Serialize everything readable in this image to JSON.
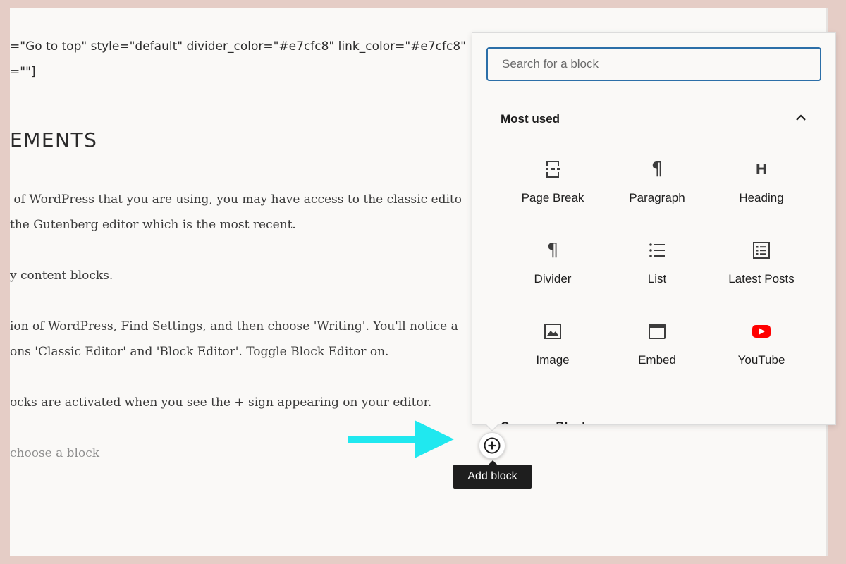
{
  "editor": {
    "shortcode_lines": [
      "=\"Go to top\" style=\"default\" divider_color=\"#e7cfc8\" link_color=\"#e7cfc8\"",
      "=\"\"]"
    ],
    "heading": "EMENTS",
    "paragraphs": [
      " of WordPress that you are using, you may have access to the classic edito",
      "the Gutenberg editor which is the most recent.",
      "y content blocks.",
      "ion of WordPress, Find Settings, and then choose 'Writing'. You'll notice a",
      "ons 'Classic Editor' and 'Block Editor'. Toggle Block Editor on.",
      "ocks are activated when you see the + sign appearing on your editor."
    ],
    "placeholder": "choose a block"
  },
  "add_block": {
    "tooltip": "Add block"
  },
  "inserter": {
    "search_placeholder": "Search for a block",
    "section_title": "Most used",
    "blocks": [
      {
        "label": "Page Break",
        "icon": "page-break-icon"
      },
      {
        "label": "Paragraph",
        "icon": "paragraph-icon"
      },
      {
        "label": "Heading",
        "icon": "heading-icon"
      },
      {
        "label": "Divider",
        "icon": "paragraph-icon"
      },
      {
        "label": "List",
        "icon": "list-icon"
      },
      {
        "label": "Latest Posts",
        "icon": "latest-posts-icon"
      },
      {
        "label": "Image",
        "icon": "image-icon"
      },
      {
        "label": "Embed",
        "icon": "embed-icon"
      },
      {
        "label": "YouTube",
        "icon": "youtube-icon"
      }
    ],
    "next_section_title": "Common Blocks"
  },
  "colors": {
    "arrow": "#20e8ef",
    "search_border": "#2c6fa8",
    "youtube_red": "#ff0000",
    "frame": "#e5cdc6"
  }
}
